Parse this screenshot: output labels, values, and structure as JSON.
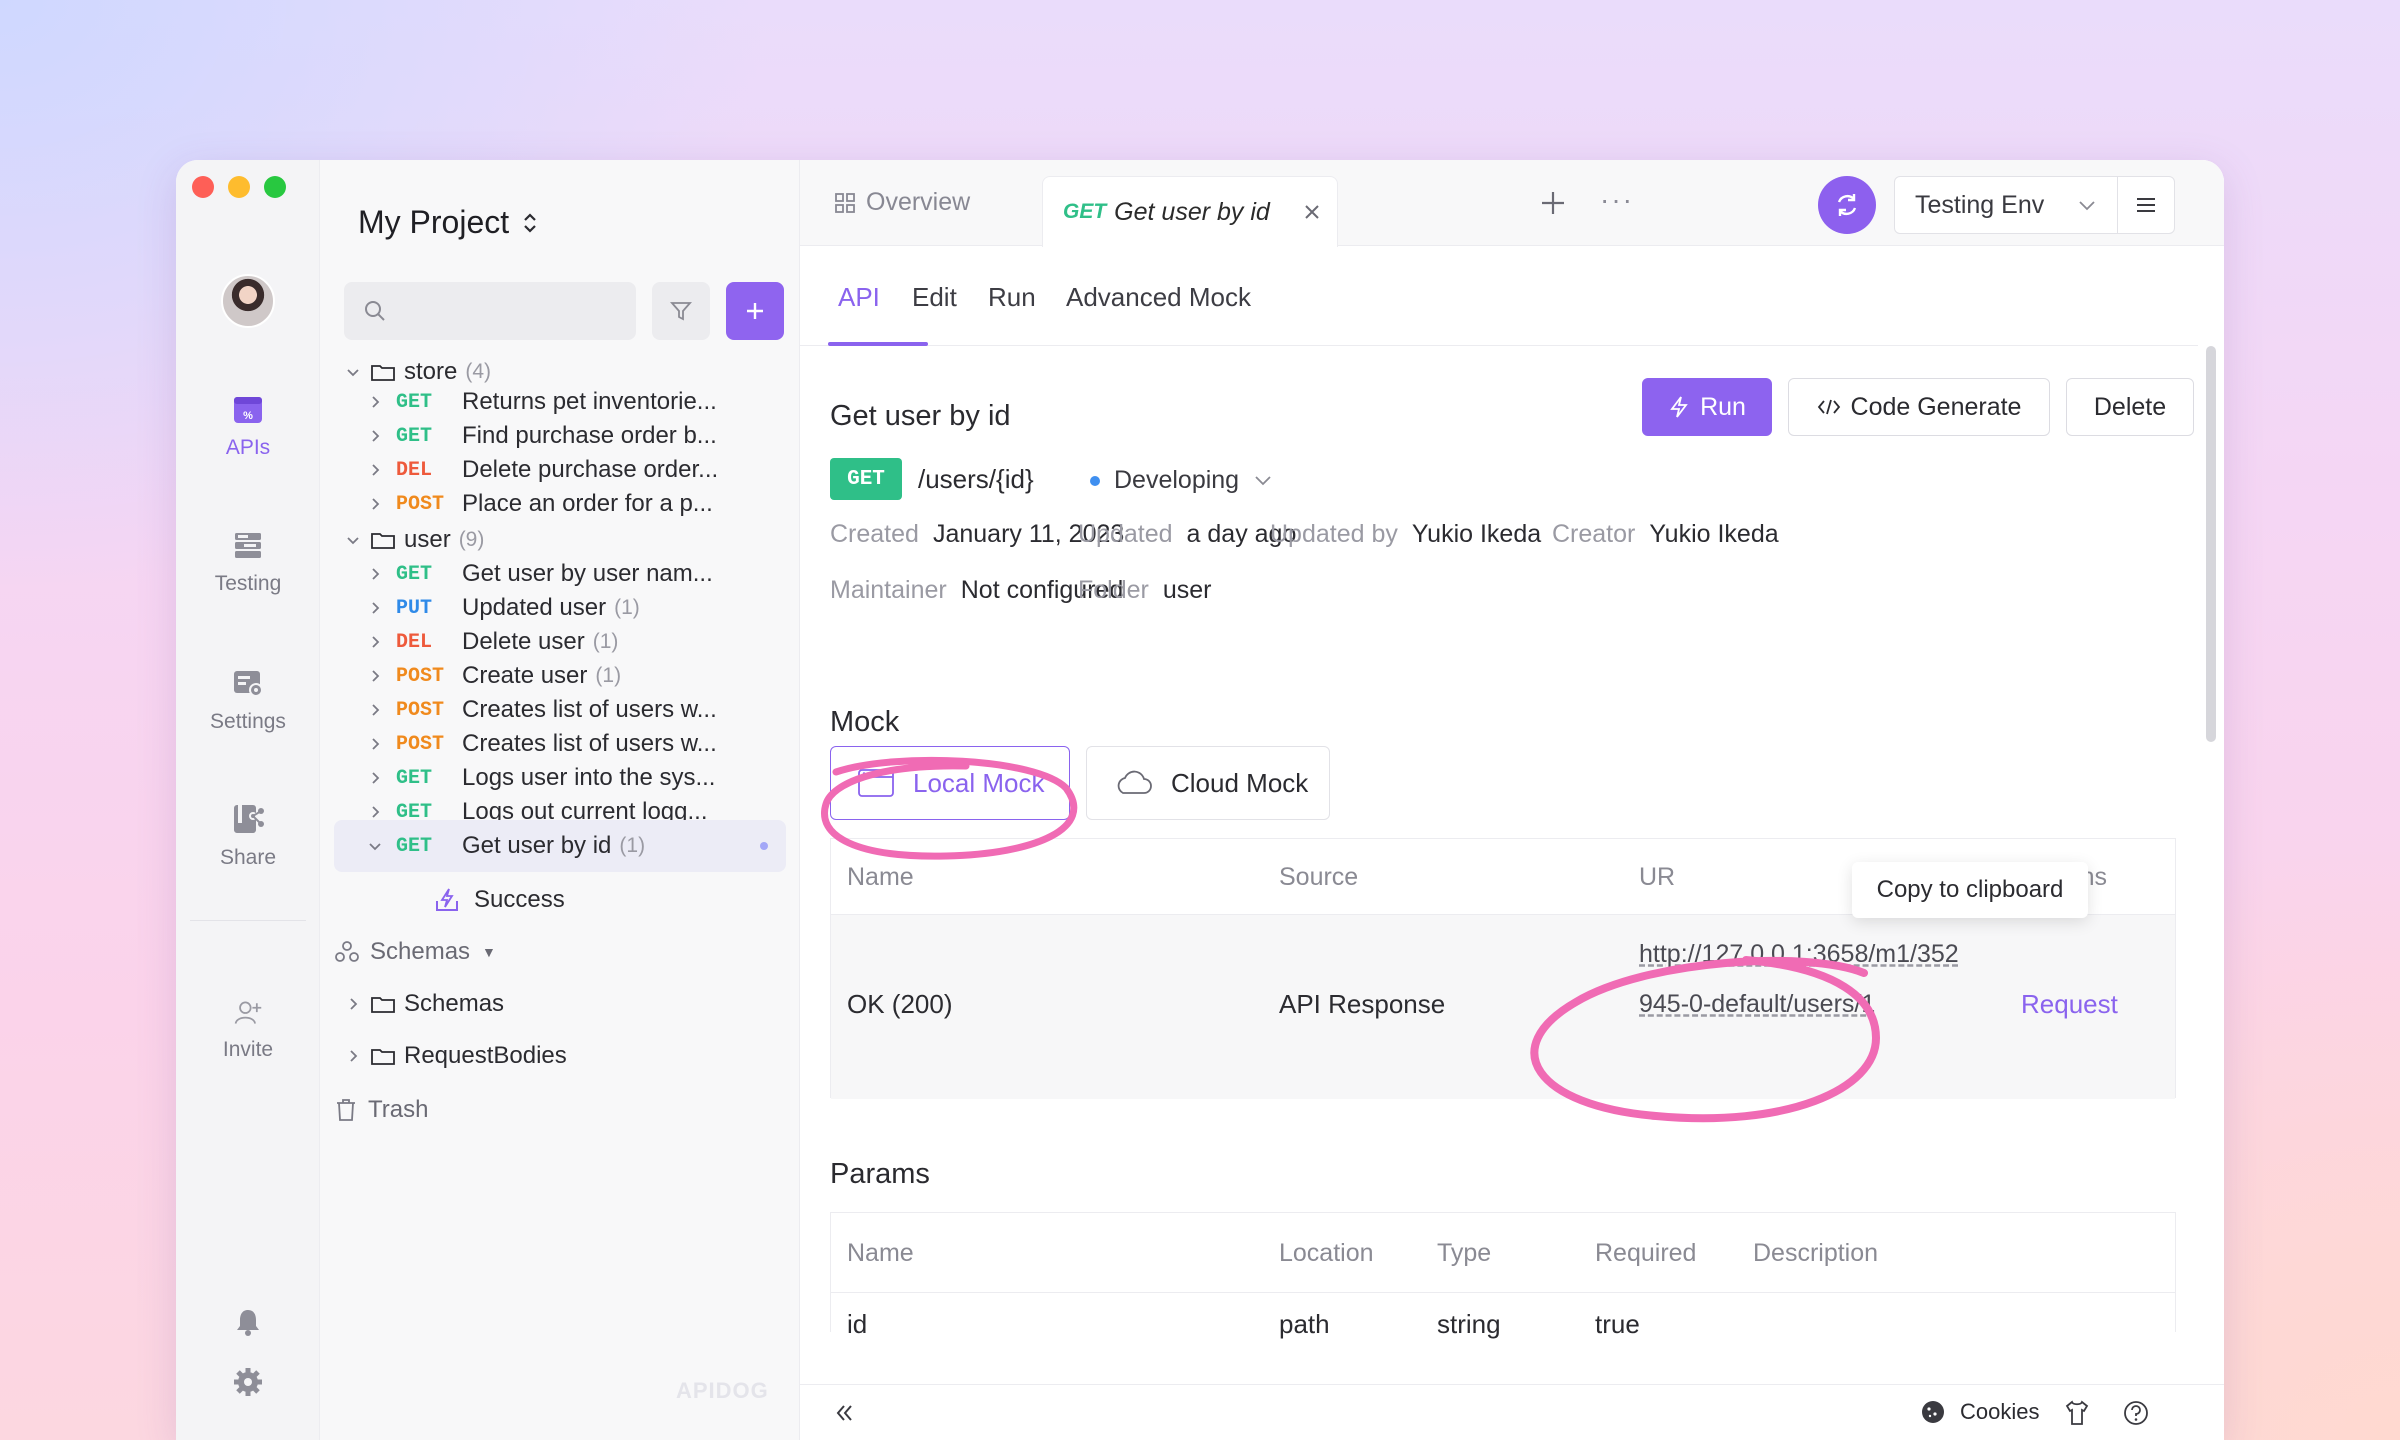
{
  "rail": {
    "items": [
      {
        "label": "APIs",
        "icon": "apis-icon"
      },
      {
        "label": "Testing",
        "icon": "testing-icon"
      },
      {
        "label": "Settings",
        "icon": "settings-icon"
      },
      {
        "label": "Share",
        "icon": "share-icon"
      },
      {
        "label": "Invite",
        "icon": "invite-icon"
      }
    ]
  },
  "sidebar": {
    "project_title": "My Project",
    "search_placeholder": "",
    "tree": [
      {
        "type": "folder",
        "label": "store",
        "count": "(4)"
      },
      {
        "method": "GET",
        "label": "Returns pet inventorie..."
      },
      {
        "method": "GET",
        "label": "Find purchase order b..."
      },
      {
        "method": "DEL",
        "label": "Delete purchase order..."
      },
      {
        "method": "POST",
        "label": "Place an order for a p..."
      },
      {
        "type": "folder",
        "label": "user",
        "count": "(9)"
      },
      {
        "method": "GET",
        "label": "Get user by user nam..."
      },
      {
        "method": "PUT",
        "label": "Updated user",
        "count": "(1)"
      },
      {
        "method": "DEL",
        "label": "Delete user",
        "count": "(1)"
      },
      {
        "method": "POST",
        "label": "Create user",
        "count": "(1)"
      },
      {
        "method": "POST",
        "label": "Creates list of users w..."
      },
      {
        "method": "POST",
        "label": "Creates list of users w..."
      },
      {
        "method": "GET",
        "label": "Logs user into the sys..."
      },
      {
        "method": "GET",
        "label": "Logs out current logg..."
      },
      {
        "method": "GET",
        "label": "Get user by id",
        "count": "(1)"
      },
      {
        "type": "case",
        "label": "Success"
      }
    ],
    "schemas_label": "Schemas",
    "schema_folders": [
      "Schemas",
      "RequestBodies"
    ],
    "trash_label": "Trash",
    "watermark": "APIDOG"
  },
  "tabs": {
    "overview": "Overview",
    "active_method": "GET",
    "active_label": "Get user by id",
    "more": "···"
  },
  "env": {
    "label": "Testing Env"
  },
  "subtabs": [
    "API",
    "Edit",
    "Run",
    "Advanced Mock"
  ],
  "api": {
    "title": "Get user by id",
    "method": "GET",
    "path": "/users/{id}",
    "status": "Developing",
    "buttons": {
      "run": "Run",
      "code": "Code Generate",
      "delete": "Delete"
    },
    "meta": {
      "created_k": "Created",
      "created_v": "January 11, 2023",
      "updated_k": "Updated",
      "updated_v": "a day ago",
      "updated_by_k": "Updated by",
      "updated_by_v": "Yukio Ikeda",
      "creator_k": "Creator",
      "creator_v": "Yukio Ikeda",
      "maintainer_k": "Maintainer",
      "maintainer_v": "Not configured",
      "folder_k": "Folder",
      "folder_v": "user"
    }
  },
  "mock": {
    "title": "Mock",
    "tabs": {
      "local": "Local Mock",
      "cloud": "Cloud Mock"
    },
    "headers": {
      "name": "Name",
      "source": "Source",
      "url": "UR",
      "actions": "Actions"
    },
    "row": {
      "name": "OK (200)",
      "source": "API Response",
      "url": "http://127.0.0.1:3658/m1/352945-0-default/users/1",
      "action": "Request"
    },
    "tooltip": "Copy to clipboard"
  },
  "params": {
    "title": "Params",
    "headers": [
      "Name",
      "Location",
      "Type",
      "Required",
      "Description"
    ],
    "row": [
      "id",
      "path",
      "string",
      "true",
      ""
    ]
  },
  "footer": {
    "cookies": "Cookies"
  },
  "colors": {
    "accent": "#8a63ee",
    "get": "#2fbf88",
    "del": "#ee5a3c",
    "post": "#f08a1d",
    "put": "#2f8ae8",
    "annotation": "#f06bb4"
  }
}
